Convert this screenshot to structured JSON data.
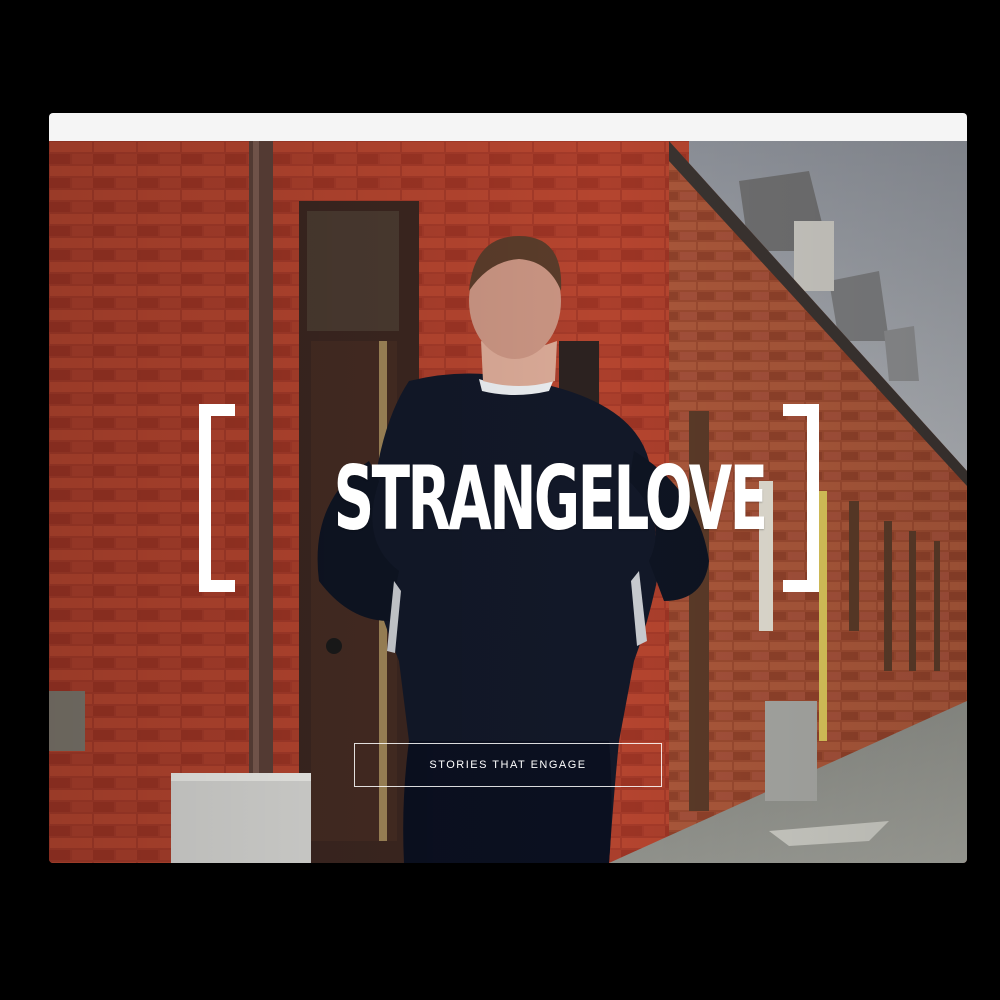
{
  "brand": {
    "logo_text": "STRANGELOVE",
    "text_color": "#ffffff"
  },
  "hero": {
    "cta_label": "STORIES THAT ENGAGE",
    "image_description_icon": "runner-on-brick-street-photo"
  },
  "colors": {
    "window_bar": "#f5f5f5",
    "page_background": "#000000",
    "brick": "#a8392a"
  }
}
